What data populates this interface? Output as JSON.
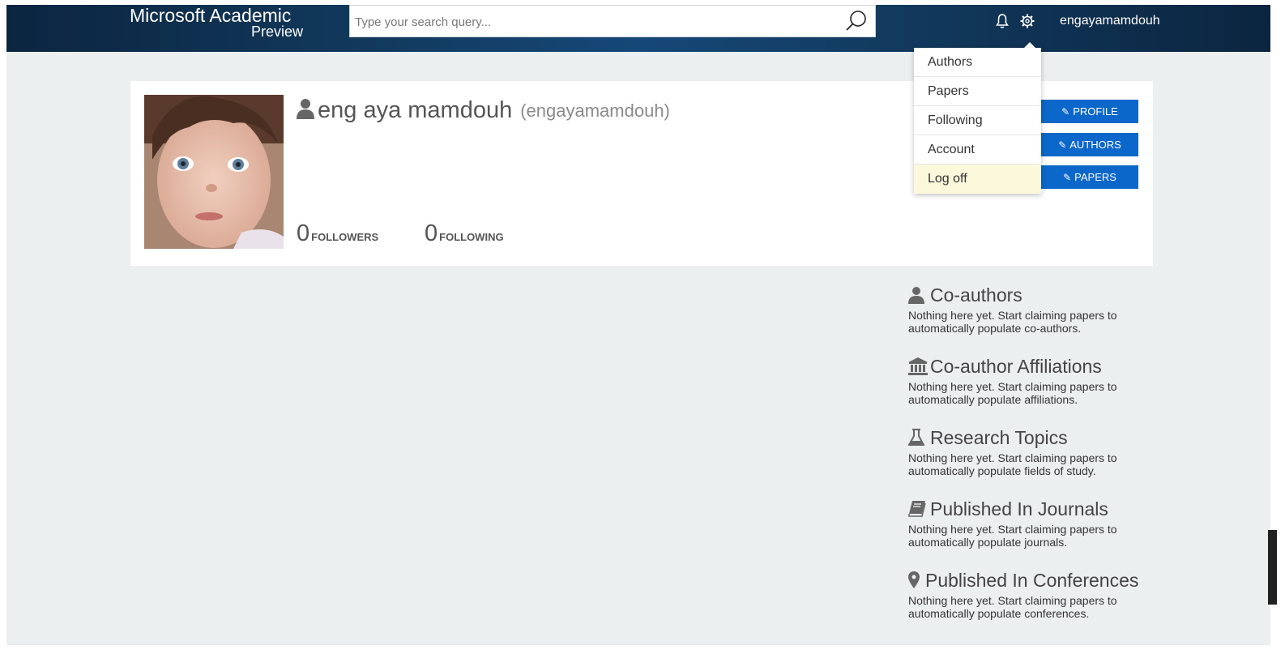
{
  "header": {
    "brand_title": "Microsoft Academic",
    "brand_sub": "Preview",
    "search_placeholder": "Type your search query...",
    "username": "engayamamdouh"
  },
  "user_menu": {
    "items": [
      "Authors",
      "Papers",
      "Following",
      "Account",
      "Log off"
    ],
    "highlighted": "Log off"
  },
  "profile": {
    "display_name": "eng aya mamdouh",
    "handle": "(engayamamdouh)",
    "followers_count": "0",
    "followers_label": "FOLLOWERS",
    "following_count": "0",
    "following_label": "FOLLOWING",
    "edit_buttons": [
      "PROFILE",
      "AUTHORS",
      "PAPERS"
    ]
  },
  "sidebar": {
    "sections": [
      {
        "icon": "person-icon",
        "title": "Co-authors",
        "text": "Nothing here yet. Start claiming papers to automatically populate co-authors."
      },
      {
        "icon": "institution-icon",
        "title": "Co-author Affiliations",
        "text": "Nothing here yet. Start claiming papers to automatically populate affiliations."
      },
      {
        "icon": "flask-icon",
        "title": "Research Topics",
        "text": "Nothing here yet. Start claiming papers to automatically populate fields of study."
      },
      {
        "icon": "book-icon",
        "title": "Published In Journals",
        "text": "Nothing here yet. Start claiming papers to automatically populate journals."
      },
      {
        "icon": "map-marker-icon",
        "title": "Published In Conferences",
        "text": "Nothing here yet. Start claiming papers to automatically populate conferences."
      }
    ]
  },
  "colors": {
    "header_dark": "#0b2540",
    "header_mid": "#154878",
    "page_bg": "#eceff0",
    "button_blue": "#0b67c9",
    "menu_hover": "#fbf8dc"
  }
}
